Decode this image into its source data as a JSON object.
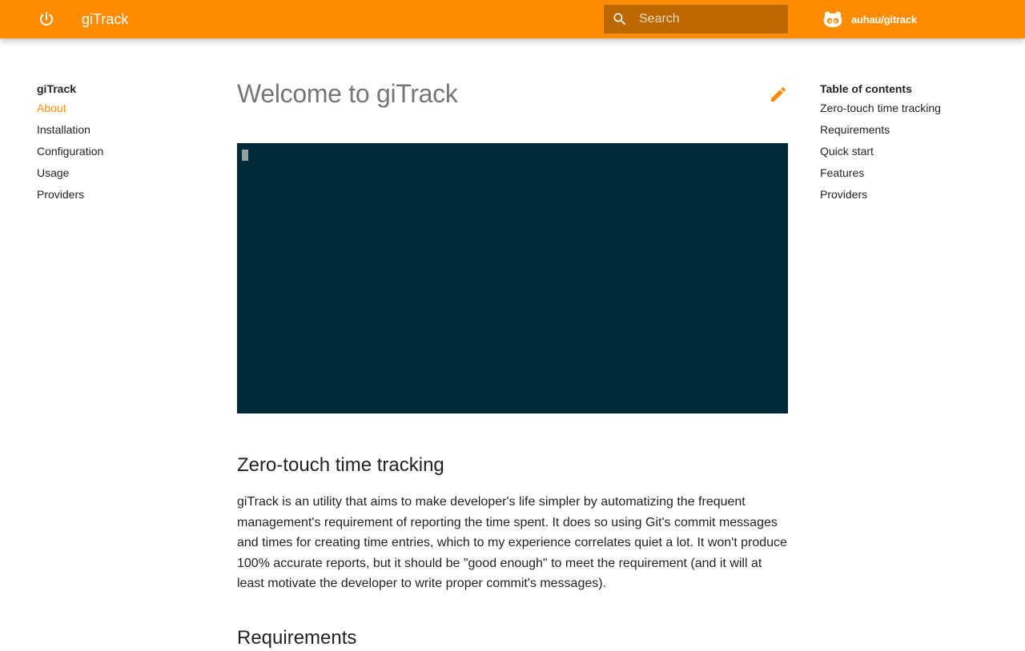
{
  "header": {
    "site_title": "giTrack",
    "search_placeholder": "Search",
    "repo_name": "auhau/gitrack",
    "bg_color": "#ff8c00"
  },
  "nav": {
    "title": "giTrack",
    "items": [
      {
        "label": "About",
        "active": true
      },
      {
        "label": "Installation"
      },
      {
        "label": "Configuration"
      },
      {
        "label": "Usage"
      },
      {
        "label": "Providers"
      }
    ]
  },
  "toc": {
    "title": "Table of contents",
    "items": [
      {
        "label": "Zero-touch time tracking"
      },
      {
        "label": "Requirements"
      },
      {
        "label": "Quick start"
      },
      {
        "label": "Features"
      },
      {
        "label": "Providers"
      }
    ]
  },
  "content": {
    "page_title": "Welcome to giTrack",
    "section1_heading": "Zero-touch time tracking",
    "section1_text": "giTrack is an utility that aims to make developer's life simpler by automatizing the frequent management's requirement of reporting the time spent. It does so using Git's commit messages and times for creating time entries, which to my experience correlates quiet a lot. It won't produce 100% accurate reports, but it should be \"good enough\" to meet the requirement (and it will at least motivate the developer to write proper commit's messages).",
    "section2_heading": "Requirements",
    "terminal_bg": "#002b36"
  },
  "icons": {
    "logo": "power-icon",
    "search": "search-icon",
    "repo": "github-octocat-icon",
    "edit": "pencil-icon"
  },
  "accent_color": "#ff8c00"
}
